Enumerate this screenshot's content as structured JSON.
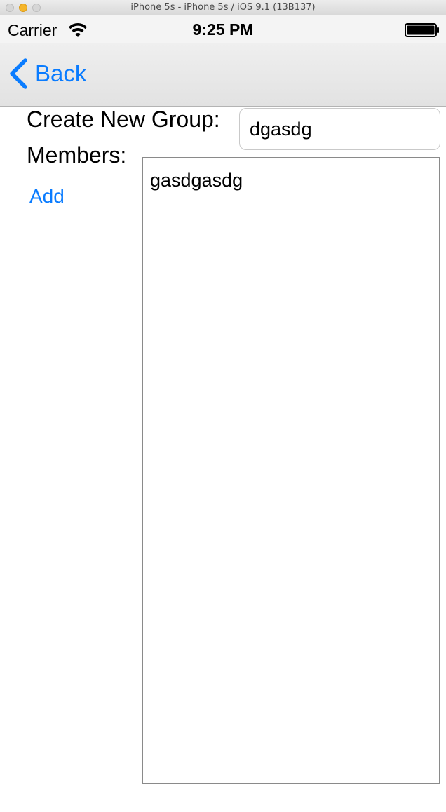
{
  "window": {
    "title": "iPhone 5s - iPhone 5s / iOS 9.1 (13B137)"
  },
  "status_bar": {
    "carrier": "Carrier",
    "time": "9:25 PM",
    "icons": [
      "wifi-icon",
      "battery-icon"
    ]
  },
  "nav_bar": {
    "back_label": "Back",
    "back_icon": "chevron-left-icon"
  },
  "form": {
    "group_label": "Create New Group:",
    "group_name_value": "dgasdg",
    "members_label": "Members:",
    "add_label": "Add",
    "members": [
      "gasdgasdg"
    ]
  },
  "colors": {
    "accent": "#0a7cff",
    "text": "#000000",
    "nav_background": "#e8e8e8"
  }
}
